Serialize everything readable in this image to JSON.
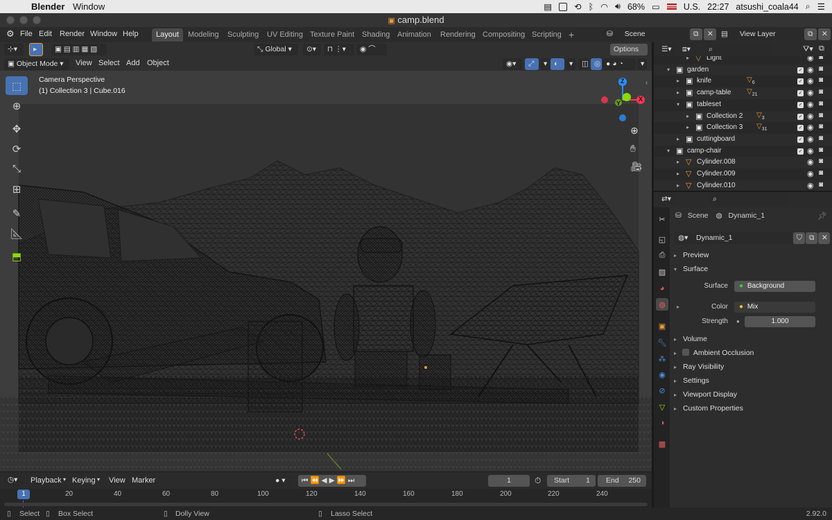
{
  "mac_menubar": {
    "app_name": "Blender",
    "menu": "Window",
    "battery": "68%",
    "input_source": "U.S.",
    "time": "22:27",
    "user": "atsushi_coala44"
  },
  "window": {
    "title": "camp.blend"
  },
  "topbar": {
    "menus": [
      "File",
      "Edit",
      "Render",
      "Window",
      "Help"
    ],
    "workspaces": [
      "Layout",
      "Modeling",
      "Sculpting",
      "UV Editing",
      "Texture Paint",
      "Shading",
      "Animation",
      "Rendering",
      "Compositing",
      "Scripting"
    ],
    "active_workspace": "Layout",
    "scene": "Scene",
    "view_layer": "View Layer"
  },
  "viewport_header": {
    "transform_orientation": "Global",
    "options_label": "Options",
    "mode": "Object Mode",
    "menus": [
      "View",
      "Select",
      "Add",
      "Object"
    ]
  },
  "viewport": {
    "camera_label": "Camera Perspective",
    "collection_label": "(1) Collection 3 | Cube.016",
    "gizmo": {
      "x": "X",
      "y": "Y",
      "z": "Z"
    }
  },
  "timeline": {
    "menus": [
      "Playback",
      "Keying",
      "View",
      "Marker"
    ],
    "current_frame": "1",
    "start_label": "Start",
    "start": "1",
    "end_label": "End",
    "end": "250",
    "ruler": [
      "1",
      "20",
      "40",
      "60",
      "80",
      "100",
      "120",
      "140",
      "160",
      "180",
      "200",
      "220",
      "240"
    ]
  },
  "statusbar": {
    "items": [
      "Select",
      "Box Select",
      "Dolly View",
      "Lasso Select"
    ],
    "version": "2.92.0"
  },
  "outliner": {
    "rows": [
      {
        "label": "Light",
        "indent": 3,
        "type": "object"
      },
      {
        "label": "garden",
        "indent": 1,
        "type": "collection"
      },
      {
        "label": "knife",
        "indent": 2,
        "type": "collection",
        "badge": "6"
      },
      {
        "label": "camp-table",
        "indent": 2,
        "type": "collection",
        "badge": "21"
      },
      {
        "label": "tableset",
        "indent": 2,
        "type": "collection"
      },
      {
        "label": "Collection 2",
        "indent": 3,
        "type": "collection",
        "badge": "3"
      },
      {
        "label": "Collection 3",
        "indent": 3,
        "type": "collection",
        "badge": "31"
      },
      {
        "label": "cuttingboard",
        "indent": 2,
        "type": "collection"
      },
      {
        "label": "camp-chair",
        "indent": 1,
        "type": "collection"
      },
      {
        "label": "Cylinder.008",
        "indent": 2,
        "type": "object"
      },
      {
        "label": "Cylinder.009",
        "indent": 2,
        "type": "object"
      },
      {
        "label": "Cylinder.010",
        "indent": 2,
        "type": "object"
      }
    ]
  },
  "properties": {
    "breadcrumb_scene": "Scene",
    "breadcrumb_world": "Dynamic_1",
    "world_name": "Dynamic_1",
    "sections": {
      "preview": "Preview",
      "surface": "Surface",
      "volume": "Volume",
      "ambient_occlusion": "Ambient Occlusion",
      "ray_visibility": "Ray Visibility",
      "settings": "Settings",
      "viewport_display": "Viewport Display",
      "custom_properties": "Custom Properties"
    },
    "surface_label": "Surface",
    "surface_value": "Background",
    "color_label": "Color",
    "color_value": "Mix",
    "strength_label": "Strength",
    "strength_value": "1.000"
  },
  "colors": {
    "accent_blue": "#4772b3",
    "orange": "#e89b3c",
    "x_axis": "#ff3352",
    "y_axis": "#8bdc00",
    "z_axis": "#2890ff"
  }
}
